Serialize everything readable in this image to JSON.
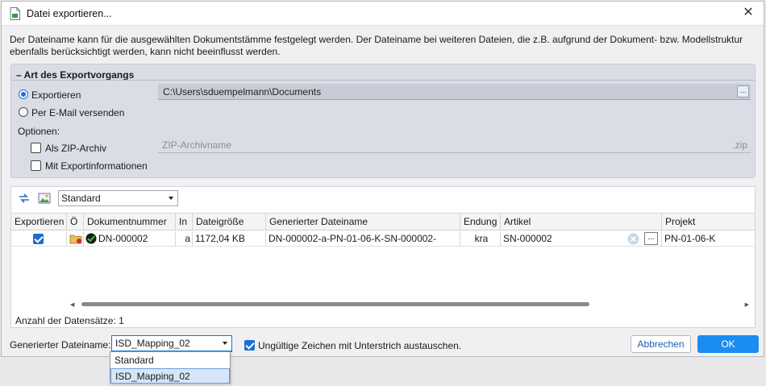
{
  "window": {
    "title": "Datei exportieren...",
    "description": "Der Dateiname kann für die ausgewählten Dokumentstämme festgelegt werden. Der Dateiname bei weiteren Dateien, die z.B. aufgrund der Dokument- bzw. Modellstruktur ebenfalls berücksichtigt werden, kann nicht beeinflusst werden."
  },
  "export_group": {
    "title": "Art des Exportvorgangs",
    "radio_export": "Exportieren",
    "radio_email": "Per E-Mail versenden",
    "export_path": "C:\\Users\\sduempelmann\\Documents",
    "browse_label": "...",
    "options_label": "Optionen:",
    "zip_label": "Als ZIP-Archiv",
    "zip_placeholder": "ZIP-Archivname",
    "zip_ext": ".zip",
    "info_label": "Mit Exportinformationen"
  },
  "table": {
    "view_selected": "Standard",
    "columns": [
      "Exportieren",
      "Ö",
      "Dokumentnummer",
      "In",
      "Dateigröße",
      "Generierter Dateiname",
      "Endung",
      "Artikel",
      "Projekt"
    ],
    "rows": [
      {
        "doc_number": "DN-000002",
        "index": "a",
        "size": "1172,04 KB",
        "generated_name": "DN-000002-a-PN-01-06-K-SN-000002-",
        "ext": "kra",
        "article": "SN-000002",
        "article_btn": "...",
        "project": "PN-01-06-K"
      }
    ],
    "record_count": "Anzahl der Datensätze: 1"
  },
  "footer": {
    "gen_label": "Generierter Dateiname:",
    "gen_selected": "ISD_Mapping_02",
    "replace_label": "Ungültige Zeichen mit Unterstrich austauschen.",
    "cancel_label": "Abbrechen",
    "ok_label": "OK",
    "dropdown_options": [
      "Standard",
      "ISD_Mapping_02"
    ]
  }
}
